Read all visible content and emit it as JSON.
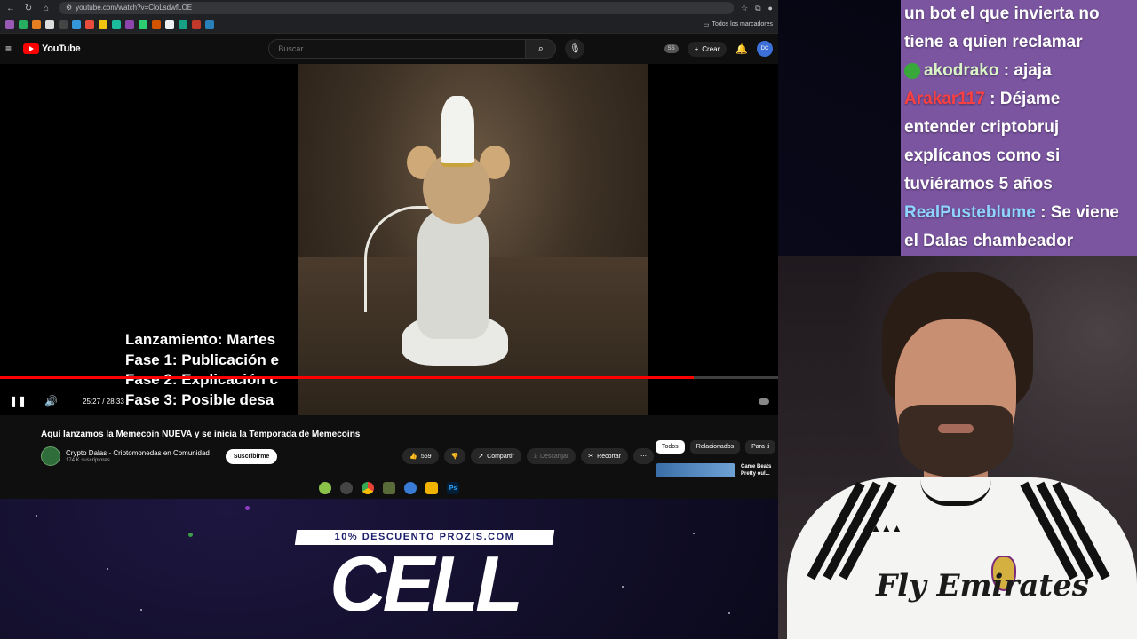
{
  "browser": {
    "url": "youtube.com/watch?v=CloLsdwfLOE",
    "bookmarks_all": "Todos los marcadores"
  },
  "youtube": {
    "logo_text": "YouTube",
    "search_placeholder": "Buscar",
    "avatar_badge": "SS",
    "create_label": "Crear",
    "account_avatar": "DC"
  },
  "player": {
    "subtitles": [
      "Lanzamiento: Martes",
      "Fase 1: Publicación e",
      "Fase 2: Explicación c",
      "Fase 3: Posible desa"
    ],
    "current_time": "25:27",
    "duration": "28:33",
    "time_display": "25:27 / 28:33",
    "progress_fraction": 0.891,
    "accent_color": "#ff0000"
  },
  "video": {
    "title": "Aquí lanzamos la Memecoin NUEVA y se inicia la Temporada de Memecoins",
    "channel_name": "Crypto Dalas - Criptomonedas en Comunidad",
    "channel_subs": "174 K suscriptores",
    "subscribe_label": "Suscribirme",
    "likes": "559",
    "share_label": "Compartir",
    "download_label": "Descargar",
    "clip_label": "Recortar",
    "more_label": "⋯"
  },
  "chips": [
    "Todos",
    "Relacionados",
    "Para ti"
  ],
  "recommendation": {
    "title": "Came Beats Pretty oul..."
  },
  "promo": {
    "tag": "10% DESCUENTO PROZIS.COM",
    "headline": "CELL"
  },
  "chat": {
    "messages": [
      {
        "user": "",
        "user_color": "#ffffff",
        "text": "un bot el que invierta no"
      },
      {
        "user": "",
        "user_color": "#ffffff",
        "text": "tiene a quien reclamar"
      },
      {
        "user": "akodrako",
        "user_color": "#d9f5c7",
        "text": ": ajaja"
      },
      {
        "user": "Arakar117",
        "user_color": "#ff4040",
        "text": ": Déjame"
      },
      {
        "user": "",
        "user_color": "#ffffff",
        "text": "entender criptobruj"
      },
      {
        "user": "",
        "user_color": "#ffffff",
        "text": "explícanos como si"
      },
      {
        "user": "",
        "user_color": "#ffffff",
        "text": "tuviéramos 5 años"
      },
      {
        "user": "RealPusteblume",
        "user_color": "#8fd3ff",
        "text": ": Se viene"
      },
      {
        "user": "",
        "user_color": "#ffffff",
        "text": "el Dalas chambeador"
      }
    ]
  },
  "webcam": {
    "shirt_text": "Fly Emirates"
  },
  "icons": {
    "search": "search-icon",
    "mic": "mic-icon",
    "bell": "bell-icon",
    "info": "info-icon",
    "pause": "pause-icon",
    "volume": "volume-icon",
    "like": "thumb-up-icon",
    "dislike": "thumb-down-icon",
    "share": "share-icon",
    "download": "download-icon",
    "clip": "scissors-icon"
  }
}
